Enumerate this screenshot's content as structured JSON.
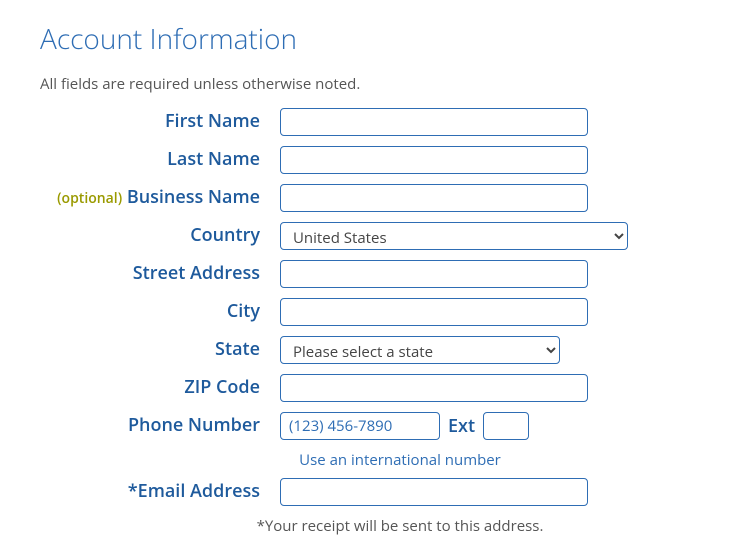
{
  "heading": "Account Information",
  "required_note": "All fields are required unless otherwise noted.",
  "fields": {
    "first_name": {
      "label": "First Name",
      "value": ""
    },
    "last_name": {
      "label": "Last Name",
      "value": ""
    },
    "business_name": {
      "label": "Business Name",
      "optional_prefix": "(optional)",
      "value": ""
    },
    "country": {
      "label": "Country",
      "selected": "United States"
    },
    "street_address": {
      "label": "Street Address",
      "value": ""
    },
    "city": {
      "label": "City",
      "value": ""
    },
    "state": {
      "label": "State",
      "selected": "Please select a state"
    },
    "zip": {
      "label": "ZIP Code",
      "value": ""
    },
    "phone": {
      "label": "Phone Number",
      "placeholder": "(123) 456-7890",
      "value": ""
    },
    "ext": {
      "label": "Ext",
      "value": ""
    },
    "email": {
      "label": "*Email Address",
      "value": ""
    }
  },
  "intl_link": "Use an international number",
  "receipt_note": "*Your receipt will be sent to this address."
}
